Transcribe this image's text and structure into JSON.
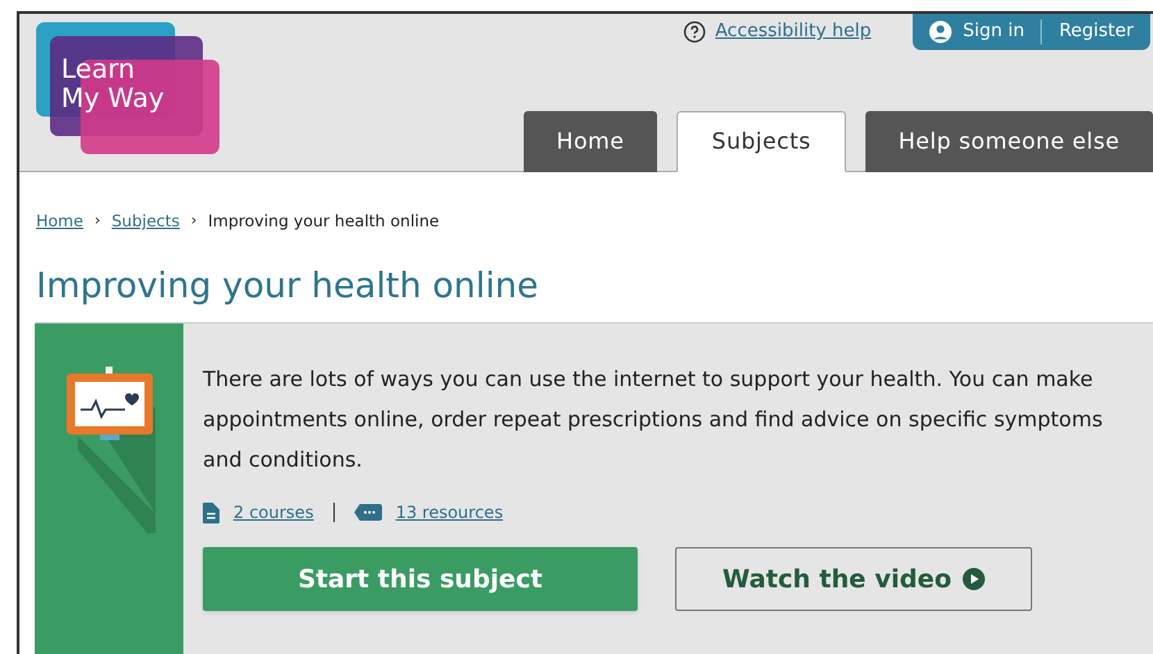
{
  "logo": {
    "line_1": "Learn",
    "line_2": "My Way"
  },
  "header": {
    "accessibility_link": "Accessibility help",
    "sign_in": "Sign in",
    "register": "Register"
  },
  "tabs": [
    {
      "label": "Home",
      "selected": false
    },
    {
      "label": "Subjects",
      "selected": true
    },
    {
      "label": "Help someone else",
      "selected": false
    }
  ],
  "breadcrumb_separator": "›",
  "breadcrumb": [
    {
      "label": "Home",
      "link": true
    },
    {
      "label": "Subjects",
      "link": true
    },
    {
      "label": "Improving your health online",
      "link": false
    }
  ],
  "title": "Improving your health online",
  "card": {
    "description": "There are lots of ways you can use the internet to support your health. You can make appointments online, order repeat prescriptions and find advice on specific symptoms and conditions.",
    "courses": "2 courses",
    "resources": "13 resources",
    "primary_button": "Start this subject",
    "secondary_button": "Watch the video"
  }
}
